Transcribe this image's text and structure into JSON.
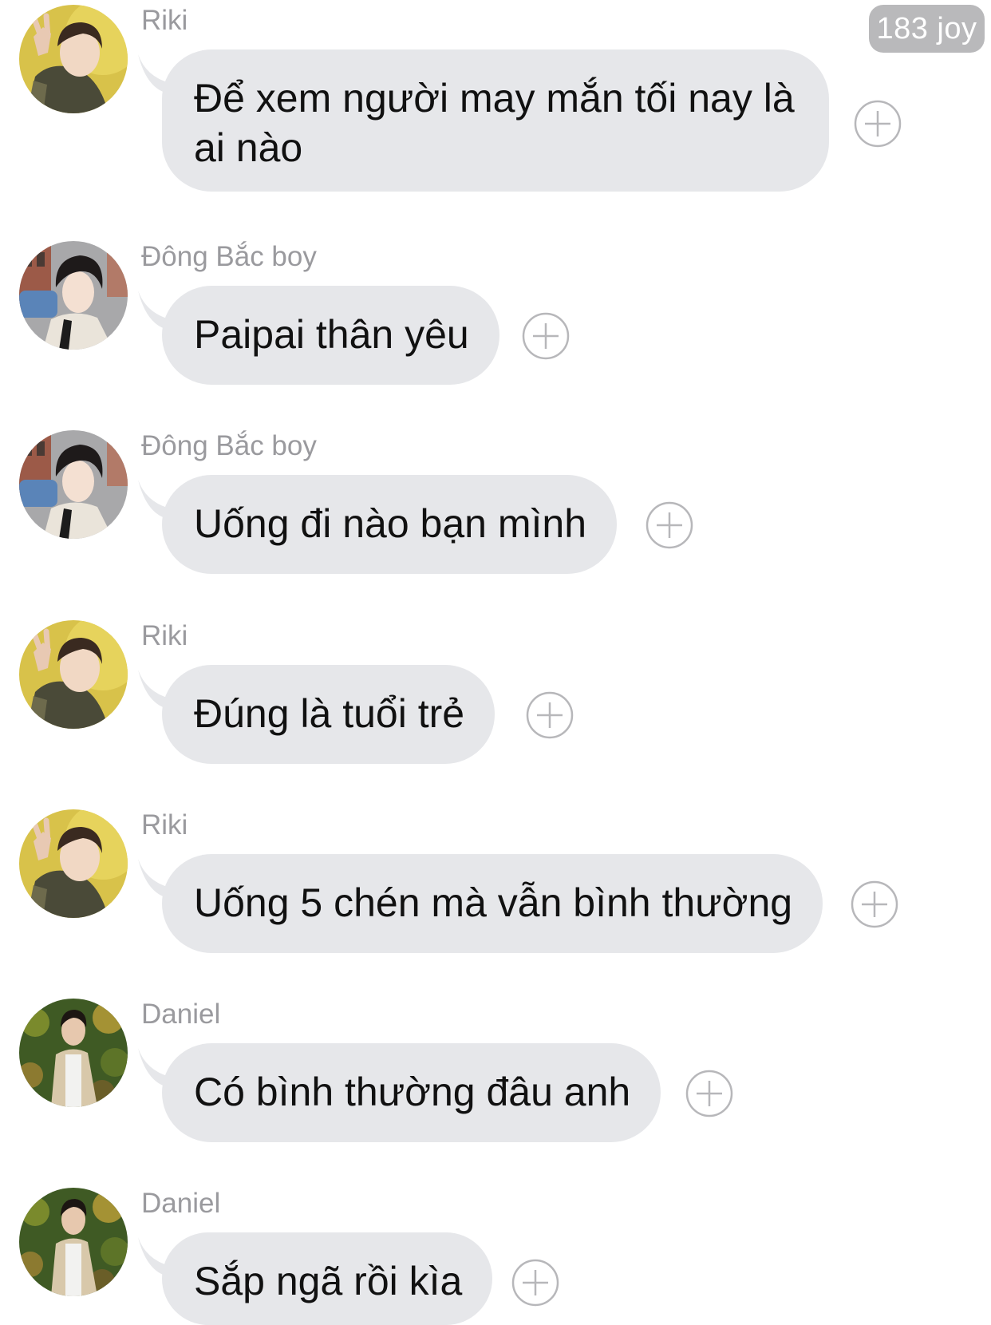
{
  "header": {
    "badge": "183 joy"
  },
  "messages": [
    {
      "sender": "Riki",
      "avatar": "riki-avatar",
      "text": "Để xem người may mắn tối nay là ai nào"
    },
    {
      "sender": "Đông Bắc boy",
      "avatar": "dongbac-avatar",
      "text": "Paipai thân yêu"
    },
    {
      "sender": "Đông Bắc boy",
      "avatar": "dongbac-avatar",
      "text": "Uống đi nào bạn mình"
    },
    {
      "sender": "Riki",
      "avatar": "riki-avatar",
      "text": "Đúng là tuổi trẻ"
    },
    {
      "sender": "Riki",
      "avatar": "riki-avatar",
      "text": "Uống 5 chén mà vẫn bình thường"
    },
    {
      "sender": "Daniel",
      "avatar": "daniel-avatar",
      "text": "Có bình thường đâu anh"
    },
    {
      "sender": "Daniel",
      "avatar": "daniel-avatar",
      "text": "Sắp ngã rồi kìa"
    }
  ],
  "icons": {
    "reaction": "plus-circle-icon"
  },
  "colors": {
    "bubble": "#e6e7ea",
    "sender": "#9a9a9e",
    "badge": "#b9b9bb"
  }
}
